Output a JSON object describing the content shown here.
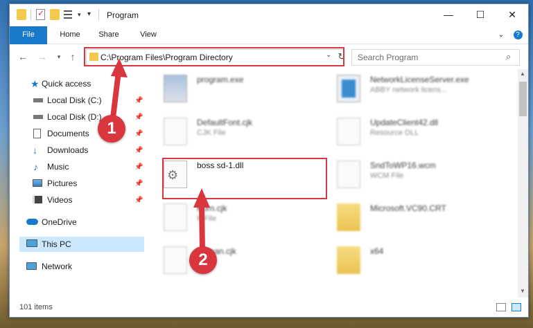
{
  "window": {
    "title": "Program"
  },
  "ribbon": {
    "tabs": [
      "File",
      "Home",
      "Share",
      "View"
    ]
  },
  "address": {
    "path": "C:\\Program Files\\Program Directory"
  },
  "search": {
    "placeholder": "Search Program"
  },
  "nav": {
    "items": [
      {
        "label": "Quick access",
        "icon": "star-icon"
      },
      {
        "label": "Local Disk (C:)",
        "icon": "drive-icon",
        "pinned": true
      },
      {
        "label": "Local Disk (D:)",
        "icon": "drive-icon",
        "pinned": true
      },
      {
        "label": "Documents",
        "icon": "documents-icon",
        "pinned": true
      },
      {
        "label": "Downloads",
        "icon": "download-icon",
        "pinned": true
      },
      {
        "label": "Music",
        "icon": "music-icon",
        "pinned": true
      },
      {
        "label": "Pictures",
        "icon": "pictures-icon",
        "pinned": true
      },
      {
        "label": "Videos",
        "icon": "videos-icon",
        "pinned": true
      },
      {
        "label": "OneDrive",
        "icon": "cloud-icon"
      },
      {
        "label": "This PC",
        "icon": "pc-icon",
        "selected": true
      },
      {
        "label": "Network",
        "icon": "network-icon"
      }
    ]
  },
  "files": [
    {
      "name": "program.exe",
      "sub": ""
    },
    {
      "name": "NetworkLicenseServer.exe",
      "sub": "ABBY network licens..."
    },
    {
      "name": "DefaultFont.cjk",
      "sub": "CJK File"
    },
    {
      "name": "UpdateClient42.dll",
      "sub": "Resource DLL"
    },
    {
      "name": "boss sd-1.dll",
      "sub": ""
    },
    {
      "name": "SndToWP16.wcm",
      "sub": "WCM File"
    },
    {
      "name": "Korn.cjk",
      "sub": "K File"
    },
    {
      "name": "Microsoft.VC90.CRT",
      "sub": ""
    },
    {
      "name": "Korean.cjk",
      "sub": ""
    },
    {
      "name": "x64",
      "sub": ""
    }
  ],
  "status": {
    "count": "101 items"
  },
  "callouts": [
    "1",
    "2"
  ],
  "colors": {
    "accent": "#1979ca",
    "highlight": "#d9363e",
    "selected": "#cce8ff"
  }
}
